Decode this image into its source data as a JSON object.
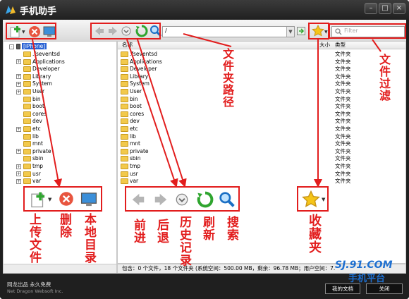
{
  "app": {
    "title": "手机助手"
  },
  "window": {
    "minimize": "–",
    "maximize": "□",
    "close": "×"
  },
  "toolbar": {
    "path_value": "/",
    "filter_placeholder": "Filter"
  },
  "tree": {
    "root": "[iPhone]",
    "items": [
      ".fseventsd",
      "Applications",
      "Developer",
      "Library",
      "System",
      "User",
      "bin",
      "boot",
      "cores",
      "dev",
      "etc",
      "lib",
      "mnt",
      "private",
      "sbin",
      "tmp",
      "usr",
      "var"
    ]
  },
  "list": {
    "col_name": "名称",
    "col_size": "大小",
    "col_type": "类型",
    "type_value": "文件夹",
    "items": [
      ".fseventsd",
      "Applications",
      "Developer",
      "Library",
      "System",
      "User",
      "bin",
      "boot",
      "cores",
      "dev",
      "etc",
      "lib",
      "mnt",
      "private",
      "sbin",
      "tmp",
      "usr",
      "var"
    ]
  },
  "status": {
    "text": "包含：0 个文件，18 个文件夹 (系统空间：500.00 MB，剩余：96.78 MB；用户空间：7."
  },
  "footer": {
    "brand": "网龙出品 永久免费",
    "brand_en": "Net Dragon Websoft Inc.",
    "docs_button": "我的文档",
    "close_button": "关闭"
  },
  "annotations": {
    "path_label": "文件夹路径",
    "filter_label": "文件过滤",
    "upload": "上传文件",
    "delete": "删除",
    "local": "本地目录",
    "forward": "前进",
    "back": "后退",
    "history": "历史记录",
    "refresh": "刷新",
    "search": "搜索",
    "favorites": "收藏夹"
  },
  "watermark": {
    "site": "SJ.91.COM",
    "name": "手机平台"
  },
  "colors": {
    "annotation": "#e21d1d",
    "selection": "#2a63d4",
    "folder": "#f2c94c"
  }
}
